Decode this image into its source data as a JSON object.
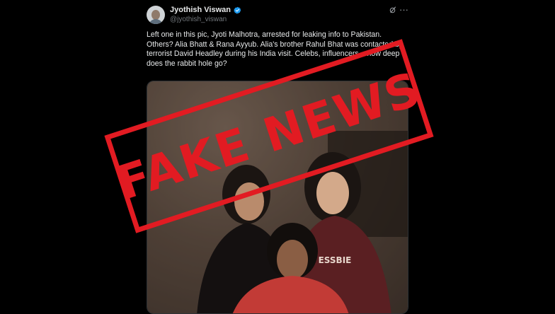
{
  "author": {
    "display_name": "Jyothish Viswan",
    "handle": "@jyothish_viswan"
  },
  "tweet": {
    "text": "Left one in this pic, Jyoti Malhotra, arrested for leaking info to Pakistan. Others? Alia Bhatt & Rana Ayyub. Alia's brother Rahul Bhat was contacted by terrorist David Headley during his India visit. Celebs, influencers... how deep does the rabbit hole go?"
  },
  "overlay": {
    "stamp_text": "FAKE NEWS",
    "stamp_color": "#e21b22"
  },
  "photo": {
    "shirt_text": "ESSBIE"
  },
  "colors": {
    "background": "#000000",
    "verified": "#1d9bf0"
  }
}
